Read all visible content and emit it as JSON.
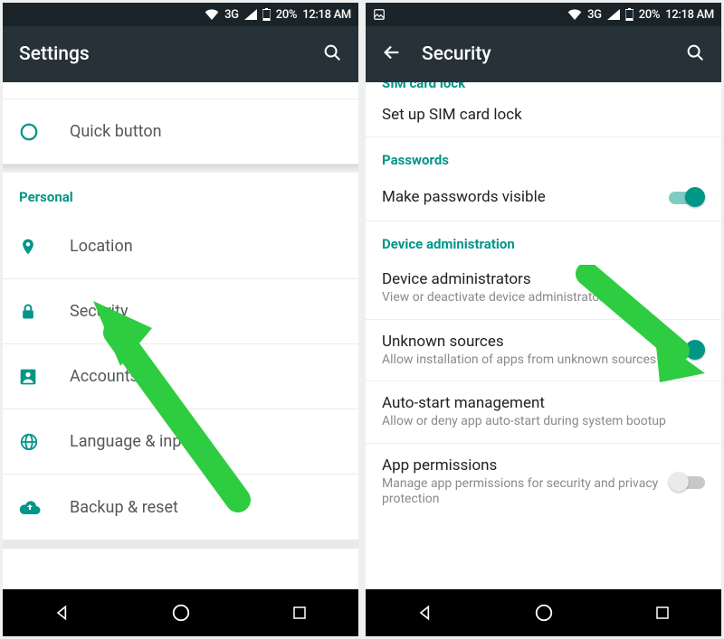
{
  "statusbar": {
    "network": "3G",
    "battery": "20%",
    "time": "12:18 AM"
  },
  "left": {
    "title": "Settings",
    "quick_button": "Quick button",
    "section_personal": "Personal",
    "items": {
      "location": "Location",
      "security": "Security",
      "accounts": "Accounts",
      "language": "Language & input",
      "backup": "Backup & reset"
    }
  },
  "right": {
    "title": "Security",
    "sim_header_cut": "SIM card lock",
    "sim_setup": "Set up SIM card lock",
    "passwords_header": "Passwords",
    "passwords_visible": "Make passwords visible",
    "device_admin_header": "Device administration",
    "device_admins": {
      "title": "Device administrators",
      "sub": "View or deactivate device administrators"
    },
    "unknown": {
      "title": "Unknown sources",
      "sub": "Allow installation of apps from unknown sources"
    },
    "autostart": {
      "title": "Auto-start management",
      "sub": "Allow or deny app auto-start during system bootup"
    },
    "app_perms": {
      "title": "App permissions",
      "sub": "Manage app permissions for security and privacy protection"
    }
  }
}
